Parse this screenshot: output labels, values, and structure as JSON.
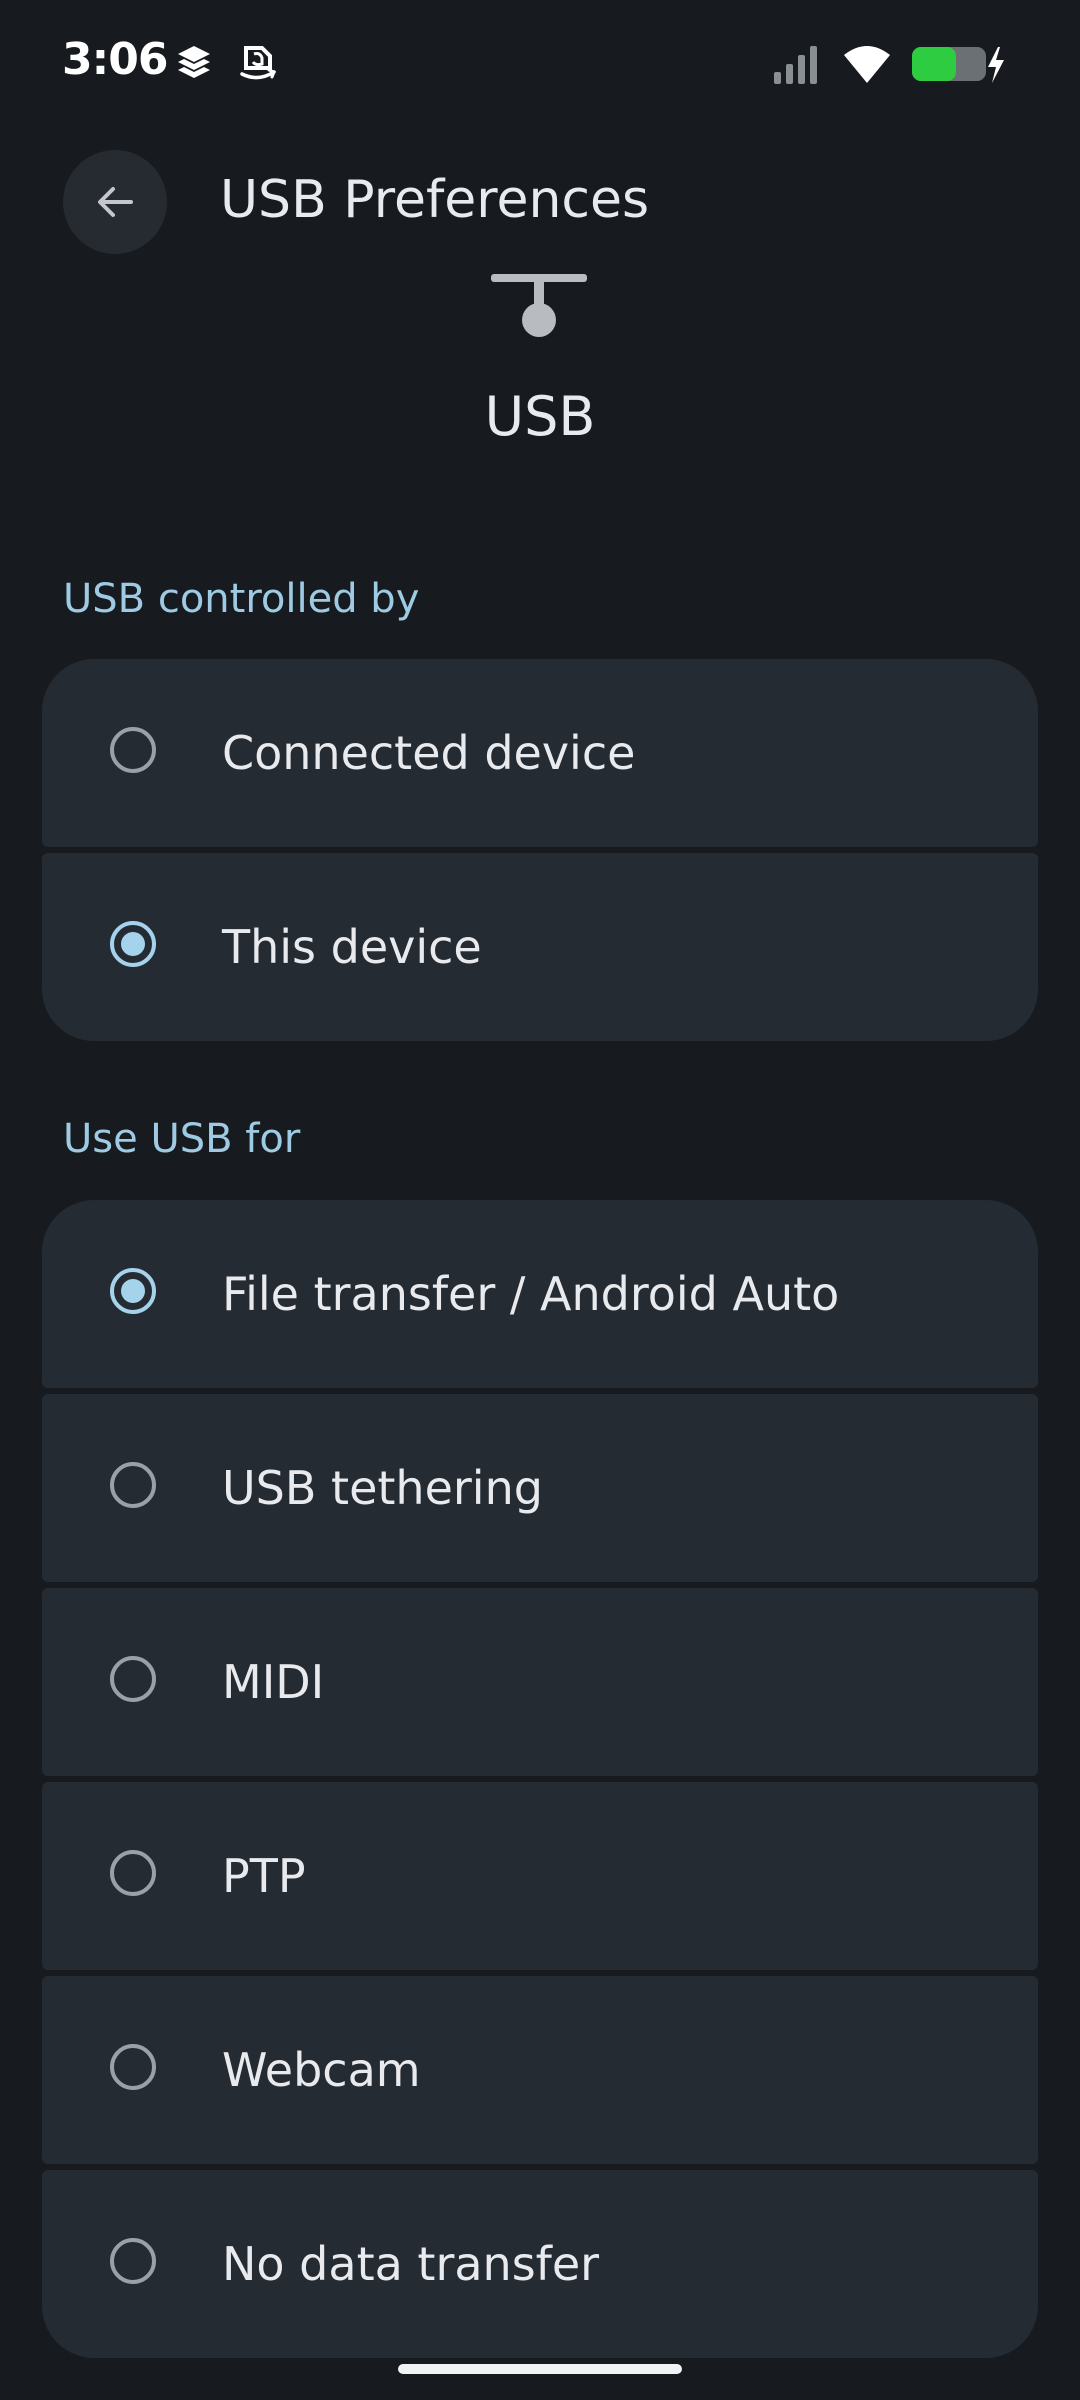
{
  "status_bar": {
    "time": "3:06",
    "notification_icons": [
      "stack-icon",
      "amazon-icon"
    ],
    "status_icons": [
      "cell-signal-icon",
      "wifi-icon",
      "battery-charging-icon"
    ],
    "battery_level": 0.6,
    "battery_color": "#2ecc40"
  },
  "app_bar": {
    "title": "USB Preferences",
    "back_icon": "arrow-back-icon"
  },
  "hero": {
    "icon": "usb-icon",
    "label": "USB"
  },
  "controlled_by": {
    "header": "USB controlled by",
    "options": [
      {
        "label": "Connected device",
        "selected": false
      },
      {
        "label": "This device",
        "selected": true
      }
    ]
  },
  "use_for": {
    "header": "Use USB for",
    "options": [
      {
        "label": "File transfer / Android Auto",
        "selected": true
      },
      {
        "label": "USB tethering",
        "selected": false
      },
      {
        "label": "MIDI",
        "selected": false
      },
      {
        "label": "PTP",
        "selected": false
      },
      {
        "label": "Webcam",
        "selected": false
      },
      {
        "label": "No data transfer",
        "selected": false
      }
    ]
  },
  "colors": {
    "background": "#171b1f",
    "card": "#252b32",
    "accent": "#9ecbe3",
    "radio_selected": "#a6d3ec"
  }
}
